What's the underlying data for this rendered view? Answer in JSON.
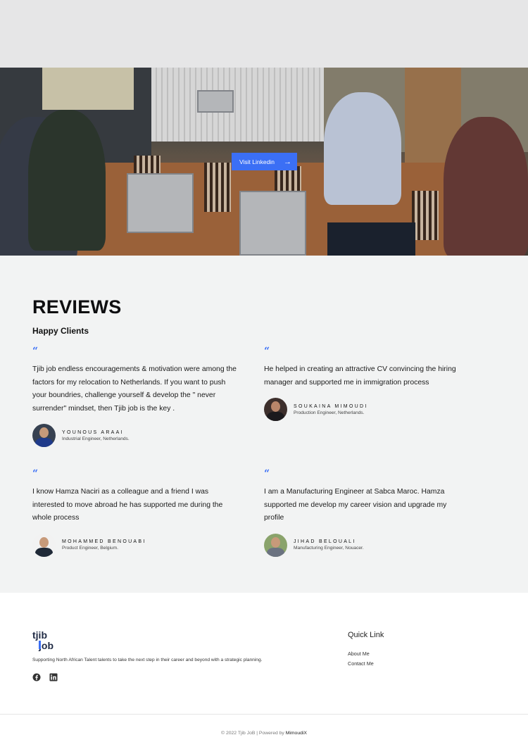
{
  "hero": {
    "button_label": "Visit Linkedin",
    "button_icon": "arrow-right-icon"
  },
  "reviews": {
    "title": "REVIEWS",
    "subtitle": "Happy Clients",
    "quote_icon": "quote-icon",
    "accent_color": "#3b6ff5",
    "items": [
      {
        "text": "Tjib job endless encouragements & motivation were among the factors for my relocation to Netherlands. If you want to push your boundries, challenge yourself & develop the \" never surrender\" mindset, then Tjib job is the key .",
        "name": "YOUNOUS ARAAI",
        "role": "Industrial Engineer, Netherlands."
      },
      {
        "text": "He helped in creating an attractive CV convincing the hiring manager and supported me in immigration process",
        "name": "SOUKAINA MIMOUDI",
        "role": "Production Engineer, Netherlands."
      },
      {
        "text": "I know Hamza Naciri as a colleague and a friend I was interested to move abroad he has supported me during the whole process",
        "name": "MOHAMMED BENOUABI",
        "role": "Product Engineer, Belgium."
      },
      {
        "text": "I am a Manufacturing Engineer at Sabca Maroc. Hamza supported me develop my career vision and upgrade my profile",
        "name": "JIHAD BELOUALI",
        "role": "Manufacturing Engineer, Nouacer."
      }
    ]
  },
  "footer": {
    "logo_text": "tjib job",
    "tagline": "Supporting North African Talent talents to take the next step in their career and beyond with a strategic planning.",
    "social_icons": [
      "facebook-icon",
      "linkedin-icon"
    ],
    "quick_link_title": "Quick Link",
    "links": [
      "About Me",
      "Contact Me"
    ],
    "copyright_prefix": "© 2022 Tjib JoB | Powered by ",
    "copyright_brand": "MimoudiX"
  }
}
